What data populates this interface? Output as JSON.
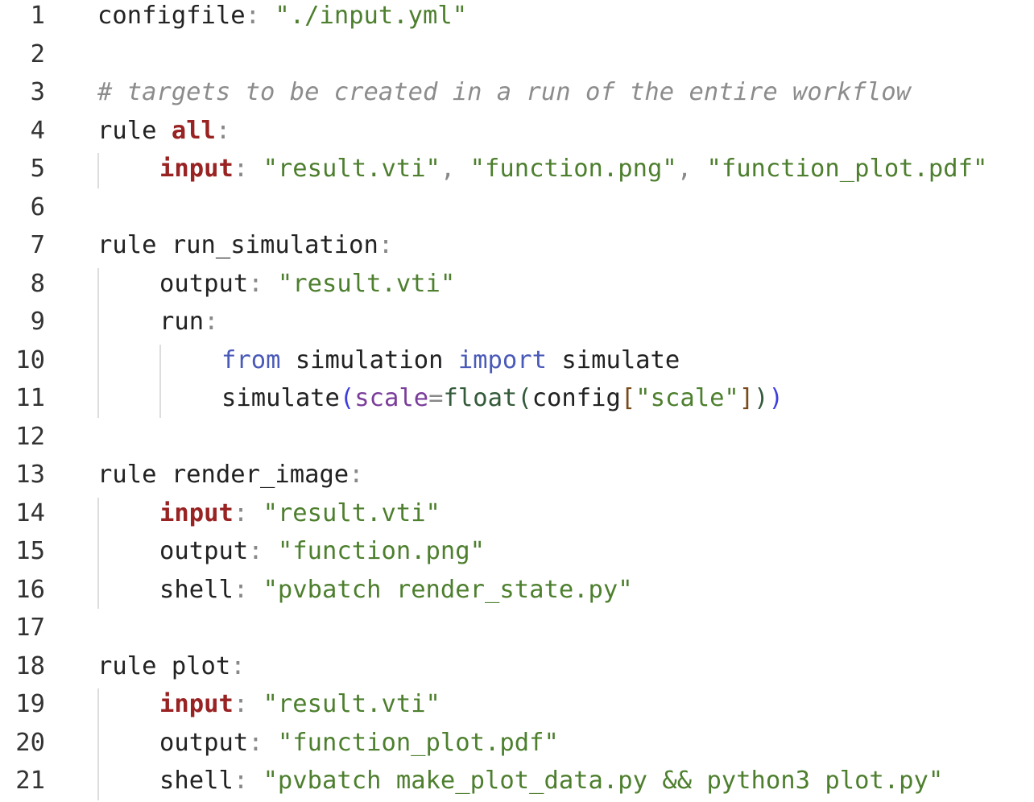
{
  "editor": {
    "lines": [
      {
        "n": "1",
        "indent": 0,
        "tokens": [
          [
            "pl",
            "configfile"
          ],
          [
            "op",
            ": "
          ],
          [
            "str",
            "\"./input.yml\""
          ]
        ]
      },
      {
        "n": "2",
        "indent": 0,
        "tokens": []
      },
      {
        "n": "3",
        "indent": 0,
        "tokens": [
          [
            "cmt",
            "# targets to be created in a run of the entire workflow"
          ]
        ]
      },
      {
        "n": "4",
        "indent": 0,
        "tokens": [
          [
            "pl",
            "rule "
          ],
          [
            "kw",
            "all"
          ],
          [
            "op",
            ":"
          ]
        ]
      },
      {
        "n": "5",
        "indent": 1,
        "tokens": [
          [
            "kw",
            "input"
          ],
          [
            "op",
            ": "
          ],
          [
            "str",
            "\"result.vti\""
          ],
          [
            "op",
            ", "
          ],
          [
            "str",
            "\"function.png\""
          ],
          [
            "op",
            ", "
          ],
          [
            "str",
            "\"function_plot.pdf\""
          ]
        ]
      },
      {
        "n": "6",
        "indent": 0,
        "tokens": []
      },
      {
        "n": "7",
        "indent": 0,
        "tokens": [
          [
            "pl",
            "rule run_simulation"
          ],
          [
            "op",
            ":"
          ]
        ]
      },
      {
        "n": "8",
        "indent": 1,
        "tokens": [
          [
            "pl",
            "output"
          ],
          [
            "op",
            ": "
          ],
          [
            "str",
            "\"result.vti\""
          ]
        ]
      },
      {
        "n": "9",
        "indent": 1,
        "tokens": [
          [
            "pl",
            "run"
          ],
          [
            "op",
            ":"
          ]
        ]
      },
      {
        "n": "10",
        "indent": 2,
        "tokens": [
          [
            "imp",
            "from"
          ],
          [
            "pl",
            " simulation "
          ],
          [
            "imp",
            "import"
          ],
          [
            "pl",
            " simulate"
          ]
        ]
      },
      {
        "n": "11",
        "indent": 2,
        "tokens": [
          [
            "pl",
            "simulate"
          ],
          [
            "paren",
            "("
          ],
          [
            "arg",
            "scale"
          ],
          [
            "op",
            "="
          ],
          [
            "bi",
            "float"
          ],
          [
            "bi",
            "("
          ],
          [
            "pl",
            "config"
          ],
          [
            "brk",
            "["
          ],
          [
            "str",
            "\"scale\""
          ],
          [
            "brk",
            "]"
          ],
          [
            "bi",
            ")"
          ],
          [
            "paren",
            ")"
          ]
        ]
      },
      {
        "n": "12",
        "indent": 0,
        "tokens": []
      },
      {
        "n": "13",
        "indent": 0,
        "tokens": [
          [
            "pl",
            "rule render_image"
          ],
          [
            "op",
            ":"
          ]
        ]
      },
      {
        "n": "14",
        "indent": 1,
        "tokens": [
          [
            "kw",
            "input"
          ],
          [
            "op",
            ": "
          ],
          [
            "str",
            "\"result.vti\""
          ]
        ]
      },
      {
        "n": "15",
        "indent": 1,
        "tokens": [
          [
            "pl",
            "output"
          ],
          [
            "op",
            ": "
          ],
          [
            "str",
            "\"function.png\""
          ]
        ]
      },
      {
        "n": "16",
        "indent": 1,
        "tokens": [
          [
            "pl",
            "shell"
          ],
          [
            "op",
            ": "
          ],
          [
            "str",
            "\"pvbatch render_state.py\""
          ]
        ]
      },
      {
        "n": "17",
        "indent": 0,
        "tokens": []
      },
      {
        "n": "18",
        "indent": 0,
        "tokens": [
          [
            "pl",
            "rule plot"
          ],
          [
            "op",
            ":"
          ]
        ]
      },
      {
        "n": "19",
        "indent": 1,
        "tokens": [
          [
            "kw",
            "input"
          ],
          [
            "op",
            ": "
          ],
          [
            "str",
            "\"result.vti\""
          ]
        ]
      },
      {
        "n": "20",
        "indent": 1,
        "tokens": [
          [
            "pl",
            "output"
          ],
          [
            "op",
            ": "
          ],
          [
            "str",
            "\"function_plot.pdf\""
          ]
        ]
      },
      {
        "n": "21",
        "indent": 1,
        "tokens": [
          [
            "pl",
            "shell"
          ],
          [
            "op",
            ": "
          ],
          [
            "str",
            "\"pvbatch make_plot_data.py && python3 plot.py\""
          ]
        ]
      }
    ]
  },
  "colors": {
    "keyword": "#992222",
    "string": "#4d7f2e",
    "comment": "#8c8c8c",
    "import_keyword": "#4a5ab8",
    "line_number": "#333333",
    "indent_guide": "#dddddd"
  }
}
